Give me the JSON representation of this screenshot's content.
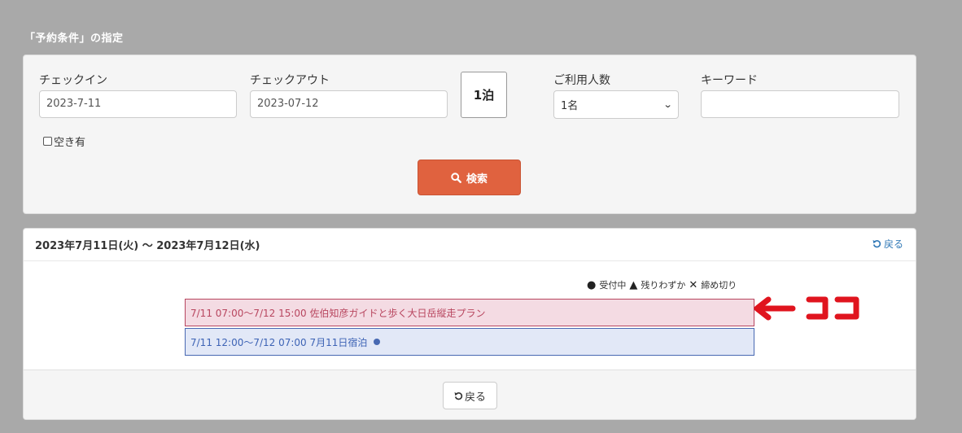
{
  "section": {
    "title": "「予約条件」の指定"
  },
  "search_form": {
    "checkin_label": "チェックイン",
    "checkin_value": "2023-7-11",
    "checkout_label": "チェックアウト",
    "checkout_value": "2023-07-12",
    "nights": "1泊",
    "guests_label": "ご利用人数",
    "guests_value": "1名",
    "keyword_label": "キーワード",
    "keyword_value": "",
    "availability_label": "空き有",
    "availability_checked": false,
    "search_label": "検索"
  },
  "results": {
    "date_range": "2023年7月11日(火) 〜 2023年7月12日(水)",
    "back_link_label": "戻る",
    "legend": {
      "open": "受付中",
      "few": "残りわずか",
      "closed": "締め切り"
    },
    "plans": [
      {
        "label": "7/11 07:00〜7/12 15:00 佐伯知彦ガイドと歩く大日岳縦走プラン",
        "highlighted": true
      },
      {
        "label": "7/11 12:00〜7/12 07:00 7月11日宿泊",
        "status": "open"
      }
    ],
    "back_button_label": "戻る"
  },
  "annotation": {
    "text": "ココ",
    "color": "#e0141e"
  },
  "colors": {
    "search_button": "#e0623f",
    "highlight_plan_bg": "#f4dbe3",
    "highlight_plan_border": "#b8465f",
    "plan_bg": "#e2e8f7",
    "plan_border": "#4869b2",
    "link": "#337ab7"
  }
}
